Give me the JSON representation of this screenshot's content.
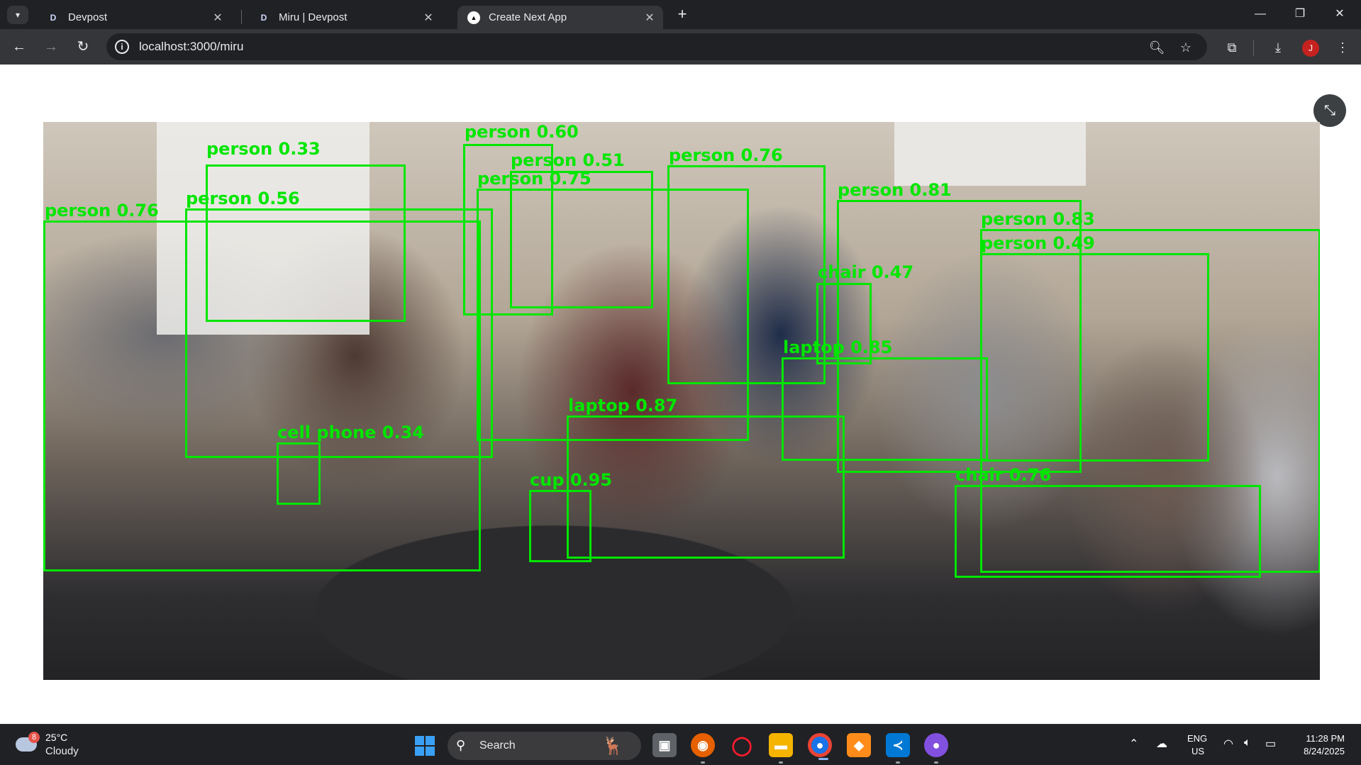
{
  "browser": {
    "tabs": [
      {
        "favicon": "D",
        "title": "Devpost",
        "close": "✕",
        "active": false
      },
      {
        "favicon": "D",
        "title": "Miru | Devpost",
        "close": "✕",
        "active": false
      },
      {
        "favicon": "▲",
        "title": "Create Next App",
        "close": "✕",
        "active": true
      }
    ],
    "new_tab": "+",
    "window_controls": {
      "minimize": "—",
      "restore": "❐",
      "close": "✕"
    },
    "nav": {
      "back": "←",
      "forward": "→",
      "reload": "↻"
    },
    "url": "localhost:3000/miru",
    "profile_initial": "J"
  },
  "page": {
    "exit_fullscreen_icon": "⤡",
    "detections": [
      {
        "label": "person 0.33"
      },
      {
        "label": "person 0.60"
      },
      {
        "label": "person 0.51"
      },
      {
        "label": "person 0.75"
      },
      {
        "label": "person 0.56"
      },
      {
        "label": "person 0.76"
      },
      {
        "label": "person 0.76"
      },
      {
        "label": "person 0.81"
      },
      {
        "label": "person 0.83"
      },
      {
        "label": "person 0.49"
      },
      {
        "label": "chair 0.47"
      },
      {
        "label": "laptop 0.85"
      },
      {
        "label": "laptop 0.87"
      },
      {
        "label": "cell phone 0.34"
      },
      {
        "label": "cup 0.95"
      },
      {
        "label": "chair 0.76"
      }
    ],
    "detection_color": "#00e600"
  },
  "taskbar": {
    "weather": {
      "badge": "8",
      "temp": "25°C",
      "condition": "Cloudy"
    },
    "search_label": "Search",
    "lang": {
      "line1": "ENG",
      "line2": "US"
    },
    "clock": {
      "time": "11:28 PM",
      "date": "8/24/2025"
    }
  }
}
